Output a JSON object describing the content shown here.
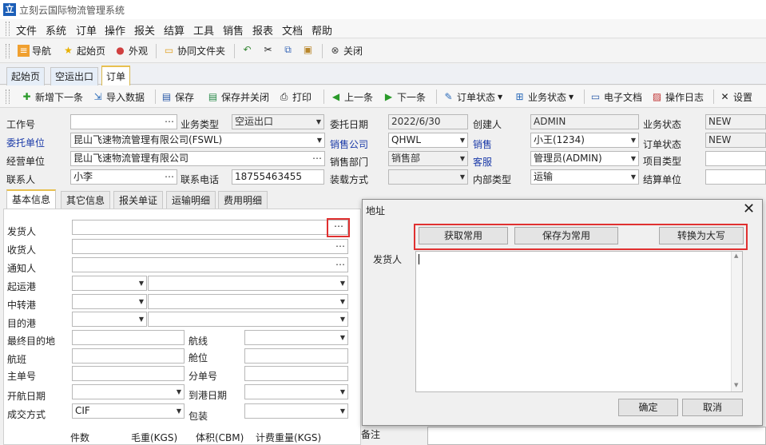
{
  "window": {
    "title": "立刻云国际物流管理系统"
  },
  "menu": [
    "文件",
    "系统",
    "订单",
    "操作",
    "报关",
    "结算",
    "工具",
    "销售",
    "报表",
    "文档",
    "帮助"
  ],
  "toolbar": {
    "nav": "导航",
    "home": "起始页",
    "appearance": "外观",
    "folder": "协同文件夹",
    "close": "关闭"
  },
  "doc_tabs": [
    "起始页",
    "空运出口",
    "订单"
  ],
  "order_toolbar": {
    "new_next": "新增下一条",
    "import": "导入数据",
    "save": "保存",
    "save_close": "保存并关闭",
    "print": "打印",
    "prev": "上一条",
    "next": "下一条",
    "order_status": "订单状态",
    "biz_status": "业务状态",
    "edoc": "电子文档",
    "oplog": "操作日志",
    "settings": "设置"
  },
  "form": {
    "job_no": {
      "label": "工作号",
      "value": ""
    },
    "biz_type": {
      "label": "业务类型",
      "value": "空运出口"
    },
    "entrust_date": {
      "label": "委托日期",
      "value": "2022/6/30"
    },
    "creator": {
      "label": "创建人",
      "value": "ADMIN"
    },
    "biz_status": {
      "label": "业务状态",
      "value": "NEW"
    },
    "client": {
      "label": "委托单位",
      "value": "昆山飞速物流管理有限公司(FSWL)"
    },
    "sales_company": {
      "label": "销售公司",
      "value": "QHWL"
    },
    "sales": {
      "label": "销售",
      "value": "小王(1234)"
    },
    "order_status": {
      "label": "订单状态",
      "value": "NEW"
    },
    "operating_unit": {
      "label": "经营单位",
      "value": "昆山飞速物流管理有限公司"
    },
    "sales_dept": {
      "label": "销售部门",
      "value": "销售部"
    },
    "cs": {
      "label": "客服",
      "value": "管理员(ADMIN)"
    },
    "project_type": {
      "label": "项目类型",
      "value": ""
    },
    "contact": {
      "label": "联系人",
      "value": "小李"
    },
    "phone": {
      "label": "联系电话",
      "value": "18755463455"
    },
    "load_method": {
      "label": "装载方式",
      "value": ""
    },
    "internal_type": {
      "label": "内部类型",
      "value": "运输"
    },
    "settle_unit": {
      "label": "结算单位",
      "value": ""
    }
  },
  "inner_tabs": [
    "基本信息",
    "其它信息",
    "报关单证",
    "运输明细",
    "费用明细"
  ],
  "basic": {
    "shipper": "发货人",
    "consignee": "收货人",
    "notify": "通知人",
    "pol": "起运港",
    "transit": "中转港",
    "pod": "目的港",
    "final_dest": "最终目的地",
    "route": "航线",
    "flight": "航班",
    "space": "舱位",
    "mbl": "主单号",
    "hbl": "分单号",
    "etd": "开航日期",
    "eta": "到港日期",
    "terms": "成交方式",
    "terms_value": "CIF",
    "packing": "包装",
    "pieces": "件数",
    "gross": "毛重(KGS)",
    "volume": "体积(CBM)",
    "chargeable": "计费重量(KGS)",
    "remarks": "备注"
  },
  "dialog": {
    "title": "地址",
    "get_common": "获取常用",
    "save_common": "保存为常用",
    "to_upper": "转换为大写",
    "shipper_label": "发货人",
    "ok": "确定",
    "cancel": "取消"
  }
}
